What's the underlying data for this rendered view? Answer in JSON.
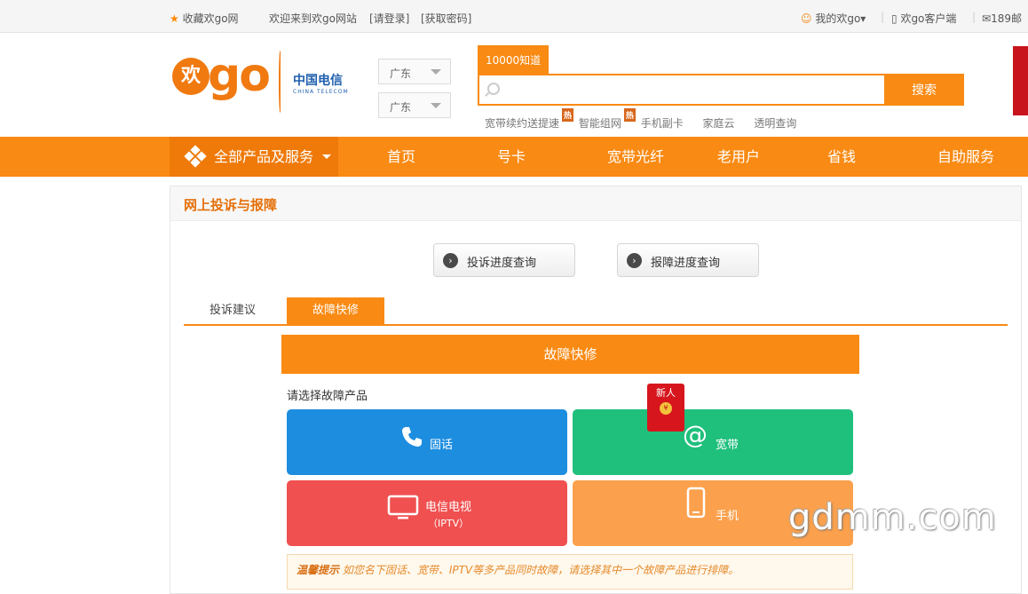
{
  "topbar": {
    "favorite": "收藏欢go网",
    "welcome": "欢迎来到欢go网站",
    "login": "[请登录]",
    "get_password": "[获取密码]",
    "my_huango": "我的欢go▾",
    "client": "欢go客户端",
    "mail": "189邮"
  },
  "header": {
    "logo_text": "欢go",
    "telecom_cn": "中国电信",
    "telecom_en": "CHINA TELECOM",
    "region_province": "广东",
    "region_city": "广东",
    "search_tab": "10000知道",
    "search_value": "",
    "search_button": "搜索",
    "hot_words": [
      "宽带续约送提速",
      "智能组网",
      "手机副卡",
      "家庭云",
      "透明查询"
    ],
    "hot_badge": "热"
  },
  "nav": {
    "all_products": "全部产品及服务",
    "items": [
      "首页",
      "号卡",
      "宽带光纤",
      "老用户",
      "省钱",
      "自助服务"
    ]
  },
  "panel": {
    "title": "网上投诉与报障",
    "complaint_query": "投诉进度查询",
    "repair_query": "报障进度查询",
    "tabs": [
      "投诉建议",
      "故障快修"
    ],
    "section_title": "故障快修",
    "prompt": "请选择故障产品",
    "products": [
      {
        "label": "固话",
        "color": "#1d8ddf"
      },
      {
        "label": "宽带",
        "color": "#1fbf7c"
      },
      {
        "label": "电信电视",
        "sub": "（IPTV）",
        "color": "#f05050"
      },
      {
        "label": "手机",
        "color": "#fba04c"
      }
    ],
    "red_pack_text": "新人",
    "red_pack_coin": "¥",
    "tip_label": "温馨提示",
    "tip_text": "如您名下固话、宽带、IPTV等多产品同时故障，请选择其中一个故障产品进行排障。"
  },
  "watermark": "gdmm.com"
}
